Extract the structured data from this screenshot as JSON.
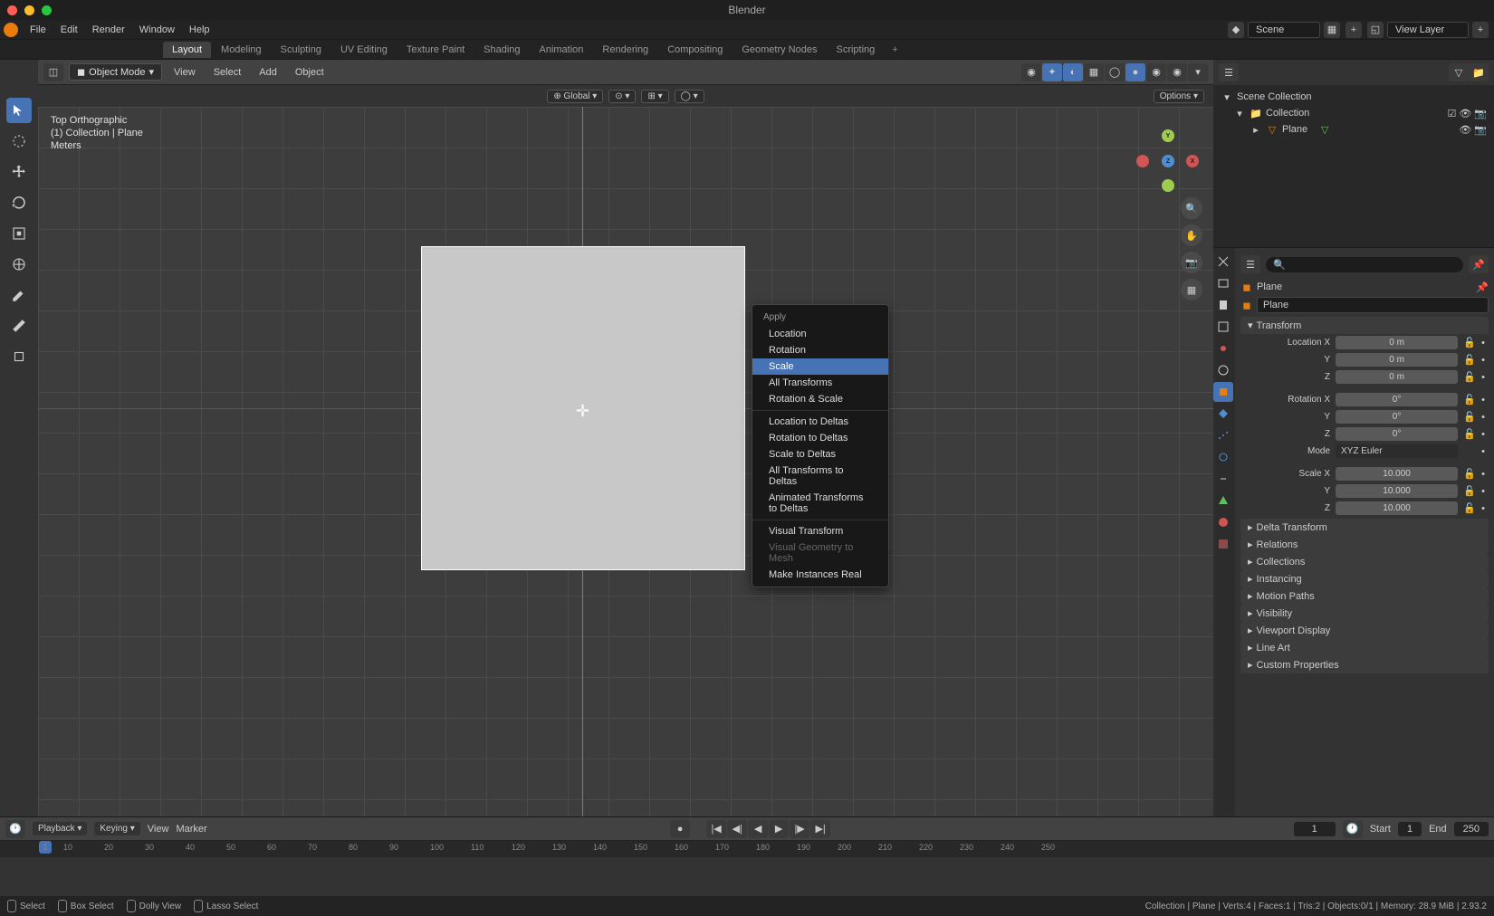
{
  "app": {
    "title": "Blender"
  },
  "menubar": {
    "file": "File",
    "edit": "Edit",
    "render": "Render",
    "window": "Window",
    "help": "Help",
    "scene_label": "Scene",
    "view_layer_label": "View Layer"
  },
  "tabs": {
    "layout": "Layout",
    "modeling": "Modeling",
    "sculpting": "Sculpting",
    "uv": "UV Editing",
    "texture": "Texture Paint",
    "shading": "Shading",
    "animation": "Animation",
    "rendering": "Rendering",
    "compositing": "Compositing",
    "geometry": "Geometry Nodes",
    "scripting": "Scripting"
  },
  "viewport": {
    "mode": "Object Mode",
    "menu": {
      "view": "View",
      "select": "Select",
      "add": "Add",
      "object": "Object"
    },
    "global": "Global",
    "options": "Options",
    "info": {
      "l1": "Top Orthographic",
      "l2": "(1) Collection | Plane",
      "l3": "Meters"
    }
  },
  "context_menu": {
    "title": "Apply",
    "items": {
      "location": "Location",
      "rotation": "Rotation",
      "scale": "Scale",
      "all": "All Transforms",
      "rotscale": "Rotation & Scale",
      "loc_delta": "Location to Deltas",
      "rot_delta": "Rotation to Deltas",
      "scale_delta": "Scale to Deltas",
      "all_delta": "All Transforms to Deltas",
      "anim_delta": "Animated Transforms to Deltas",
      "visual": "Visual Transform",
      "visual_geo": "Visual Geometry to Mesh",
      "instances": "Make Instances Real"
    }
  },
  "outliner": {
    "scene_collection": "Scene Collection",
    "collection": "Collection",
    "plane": "Plane"
  },
  "properties": {
    "object1": "Plane",
    "object2": "Plane",
    "transform": "Transform",
    "location_x": "Location X",
    "y": "Y",
    "z": "Z",
    "rotation_x": "Rotation X",
    "mode_label": "Mode",
    "mode_value": "XYZ Euler",
    "scale_x": "Scale X",
    "loc_val": "0 m",
    "rot_val": "0°",
    "scale_val": "10.000",
    "delta": "Delta Transform",
    "relations": "Relations",
    "collections": "Collections",
    "instancing": "Instancing",
    "motion": "Motion Paths",
    "visibility": "Visibility",
    "vp_display": "Viewport Display",
    "lineart": "Line Art",
    "custom": "Custom Properties"
  },
  "timeline": {
    "playback": "Playback",
    "keying": "Keying",
    "view": "View",
    "marker": "Marker",
    "frame": "1",
    "start_l": "Start",
    "start": "1",
    "end_l": "End",
    "end": "250",
    "ticks": [
      "10",
      "20",
      "30",
      "40",
      "50",
      "60",
      "70",
      "80",
      "90",
      "100",
      "110",
      "120",
      "130",
      "140",
      "150",
      "160",
      "170",
      "180",
      "190",
      "200",
      "210",
      "220",
      "230",
      "240",
      "250"
    ]
  },
  "statusbar": {
    "select": "Select",
    "box": "Box Select",
    "dolly": "Dolly View",
    "lasso": "Lasso Select",
    "info": "Collection | Plane | Verts:4 | Faces:1 | Tris:2 | Objects:0/1 | Memory: 28.9 MiB | 2.93.2"
  }
}
